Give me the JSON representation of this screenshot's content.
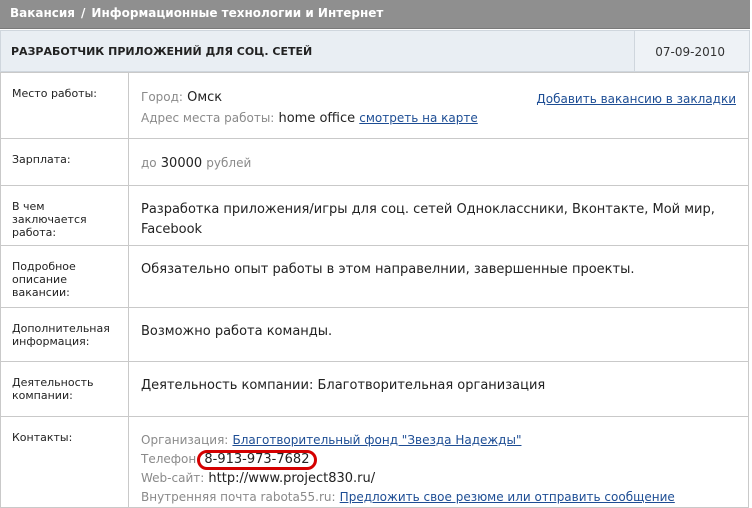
{
  "breadcrumb": {
    "part1": "Вакансия",
    "sep": "/",
    "part2": "Информационные технологии и Интернет"
  },
  "vacancy": {
    "title": "РАЗРАБОТЧИК ПРИЛОЖЕНИЙ ДЛЯ СОЦ. СЕТЕЙ",
    "date": "07-09-2010"
  },
  "location": {
    "label": "Место работы:",
    "city_label": "Город:",
    "city": "Омск",
    "address_label": "Адрес места работы:",
    "address": "home office",
    "map_link": "смотреть на карте",
    "bookmark_link": "Добавить вакансию в закладки"
  },
  "salary": {
    "label": "Зарплата:",
    "prefix": "до",
    "amount": "30000",
    "currency": "рублей"
  },
  "work": {
    "label": "В чем заключается работа:",
    "text": "Разработка приложения/игры для соц. сетей Одноклассники, Вконтакте, Мой мир, Facebook"
  },
  "description": {
    "label": "Подробное описание вакансии:",
    "text": "Обязательно опыт работы в этом направелнии, завершенные проекты."
  },
  "additional": {
    "label": "Дополнительная информация:",
    "text": "Возможно работа команды."
  },
  "company": {
    "label": "Деятельность компании:",
    "text": "Деятельность компании: Благотворительная организация"
  },
  "contacts": {
    "label": "Контакты:",
    "org_label": "Организация:",
    "org_link": "Благотворительный фонд \"Звезда Надежды\"",
    "phone_label": "Телефон:",
    "phone": "8-913-973-7682",
    "site_label": "Web-сайт:",
    "site": "http://www.project830.ru/",
    "mail_label": "Внутренняя почта rabota55.ru:",
    "mail_link": "Предложить свое резюме или отправить сообщение"
  },
  "colors": {
    "topbar": "#8f8f8f",
    "titlebar": "#e9eef3",
    "link": "#1d4d94",
    "highlight": "#d40000"
  }
}
